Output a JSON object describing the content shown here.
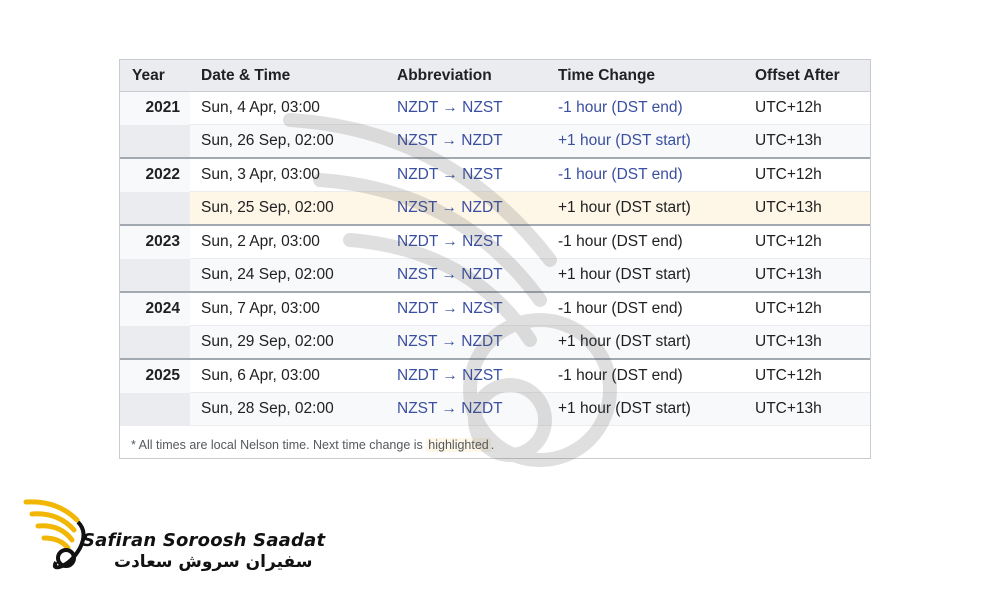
{
  "table": {
    "headers": [
      "Year",
      "Date & Time",
      "Abbreviation",
      "Time Change",
      "Offset After"
    ],
    "groups": [
      {
        "year": "2021",
        "rows": [
          {
            "date": "Sun, 4 Apr, 03:00",
            "abbr": "NZDT → NZST",
            "change": "-1 hour (DST end)",
            "offset": "UTC+12h"
          },
          {
            "date": "Sun, 26 Sep, 02:00",
            "abbr": "NZST → NZDT",
            "change": "+1 hour (DST start)",
            "offset": "UTC+13h"
          }
        ]
      },
      {
        "year": "2022",
        "rows": [
          {
            "date": "Sun, 3 Apr, 03:00",
            "abbr": "NZDT → NZST",
            "change": "-1 hour (DST end)",
            "offset": "UTC+12h"
          },
          {
            "date": "Sun, 25 Sep, 02:00",
            "abbr": "NZST → NZDT",
            "change": "+1 hour (DST start)",
            "offset": "UTC+13h"
          }
        ]
      },
      {
        "year": "2023",
        "rows": [
          {
            "date": "Sun, 2 Apr, 03:00",
            "abbr": "NZDT → NZST",
            "change": "-1 hour (DST end)",
            "offset": "UTC+12h"
          },
          {
            "date": "Sun, 24 Sep, 02:00",
            "abbr": "NZST → NZDT",
            "change": "+1 hour (DST start)",
            "offset": "UTC+13h"
          }
        ]
      },
      {
        "year": "2024",
        "rows": [
          {
            "date": "Sun, 7 Apr, 03:00",
            "abbr": "NZDT → NZST",
            "change": "-1 hour (DST end)",
            "offset": "UTC+12h"
          },
          {
            "date": "Sun, 29 Sep, 02:00",
            "abbr": "NZST → NZDT",
            "change": "+1 hour (DST start)",
            "offset": "UTC+13h"
          }
        ]
      },
      {
        "year": "2025",
        "rows": [
          {
            "date": "Sun, 6 Apr, 03:00",
            "abbr": "NZDT → NZST",
            "change": "-1 hour (DST end)",
            "offset": "UTC+12h"
          },
          {
            "date": "Sun, 28 Sep, 02:00",
            "abbr": "NZST → NZDT",
            "change": "+1 hour (DST start)",
            "offset": "UTC+13h"
          }
        ]
      }
    ],
    "note": {
      "prefix": "* All times are local Nelson time. Next time change is",
      "highlight": "highlighted",
      "suffix": "."
    }
  },
  "colors": {
    "header_bg": "#eaecf0",
    "highlight_bg": "#fef6e7",
    "link_blue": "#3a4fa0",
    "brand_gold": "#f2b705"
  },
  "brand": {
    "name_en": "Safiran Soroosh Saadat",
    "name_fa": "سفیران سروش سعادت",
    "logo_icon": "wing-logo-icon"
  }
}
